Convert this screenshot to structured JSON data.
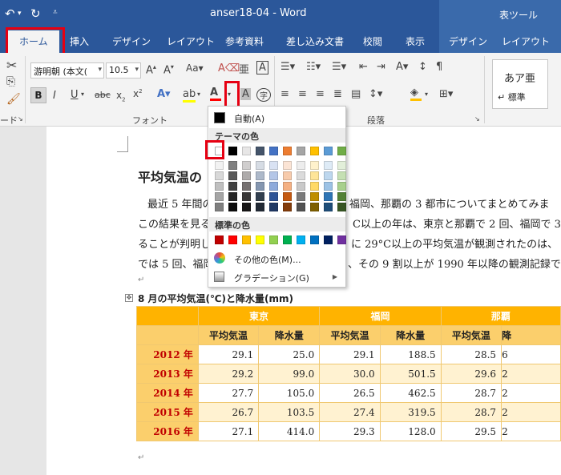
{
  "titlebar": {
    "undo_icon": "undo-icon",
    "redo_icon": "redo-icon",
    "title": "anser18-04 - Word",
    "context_tab": "表ツール"
  },
  "tabs": [
    "ホーム",
    "挿入",
    "デザイン",
    "レイアウト",
    "参考資料",
    "差し込み文書",
    "校閲",
    "表示",
    "デザイン",
    "レイアウト"
  ],
  "ribbon": {
    "font_name": "游明朝 (本文(",
    "font_size": "10.5",
    "group_font": "フォント",
    "group_paragraph": "段落",
    "group_clipboard": "ード",
    "style_sample": "あア亜",
    "style_name": "↵ 標準"
  },
  "color_menu": {
    "auto": "自動(A)",
    "theme_colors": "テーマの色",
    "standard_colors": "標準の色",
    "more_colors": "その他の色(M)...",
    "gradient": "グラデーション(G)",
    "theme_top": [
      "#ffffff",
      "#000000",
      "#e7e6e6",
      "#44546a",
      "#4472c4",
      "#ed7d31",
      "#a5a5a5",
      "#ffc000",
      "#5b9bd5",
      "#70ad47"
    ],
    "theme_shades": [
      [
        "#f2f2f2",
        "#808080",
        "#d0cece",
        "#d6dce4",
        "#d9e2f3",
        "#fbe4d5",
        "#ededed",
        "#fff2cc",
        "#deebf6",
        "#e2efd9"
      ],
      [
        "#d8d8d8",
        "#595959",
        "#aeabab",
        "#adb9ca",
        "#b4c6e7",
        "#f7cbac",
        "#dbdbdb",
        "#fee599",
        "#bdd7ee",
        "#c5e0b3"
      ],
      [
        "#bfbfbf",
        "#404040",
        "#757070",
        "#8496b0",
        "#8eaadb",
        "#f4b083",
        "#c9c9c9",
        "#ffd965",
        "#9cc2e5",
        "#a8d08d"
      ],
      [
        "#a5a5a5",
        "#262626",
        "#3a3838",
        "#323f4f",
        "#2f5496",
        "#c45911",
        "#7b7b7b",
        "#bf8f00",
        "#2e75b5",
        "#538135"
      ],
      [
        "#7f7f7f",
        "#0d0d0d",
        "#171616",
        "#222a35",
        "#1f3864",
        "#833c0b",
        "#525252",
        "#7f6000",
        "#1e4e79",
        "#375623"
      ]
    ],
    "standard": [
      "#c00000",
      "#ff0000",
      "#ffc000",
      "#ffff00",
      "#92d050",
      "#00b050",
      "#00b0f0",
      "#0070c0",
      "#002060",
      "#7030a0"
    ]
  },
  "document": {
    "heading": "平均気温の",
    "lines": [
      "最近 5 年間の",
      "この結果を見る",
      "ることが判明し",
      "では 5 回、福岡"
    ],
    "lines_right": [
      "福岡、那覇の 3 都市についてまとめてみま",
      "C以上の年は、東京と那覇で 2 回、福岡で 3",
      "に 29°C以上の平均気温が観測されたのは、",
      "、その 9 割以上が 1990 年以降の観測記録で"
    ],
    "table_caption": "8 月の平均気温(℃)と降水量(mm)",
    "cities": [
      "東京",
      "福岡",
      "那覇"
    ],
    "subheaders": [
      "平均気温",
      "降水量",
      "平均気温",
      "降水量",
      "平均気温",
      "降"
    ],
    "rows": [
      {
        "year": "2012 年",
        "values": [
          "29.1",
          "25.0",
          "29.1",
          "188.5",
          "28.5",
          "6"
        ]
      },
      {
        "year": "2013 年",
        "values": [
          "29.2",
          "99.0",
          "30.0",
          "501.5",
          "29.6",
          "2"
        ]
      },
      {
        "year": "2014 年",
        "values": [
          "27.7",
          "105.0",
          "26.5",
          "462.5",
          "28.7",
          "2"
        ]
      },
      {
        "year": "2015 年",
        "values": [
          "26.7",
          "103.5",
          "27.4",
          "319.5",
          "28.7",
          "2"
        ]
      },
      {
        "year": "2016 年",
        "values": [
          "27.1",
          "414.0",
          "29.3",
          "128.0",
          "29.5",
          "2"
        ]
      }
    ]
  }
}
